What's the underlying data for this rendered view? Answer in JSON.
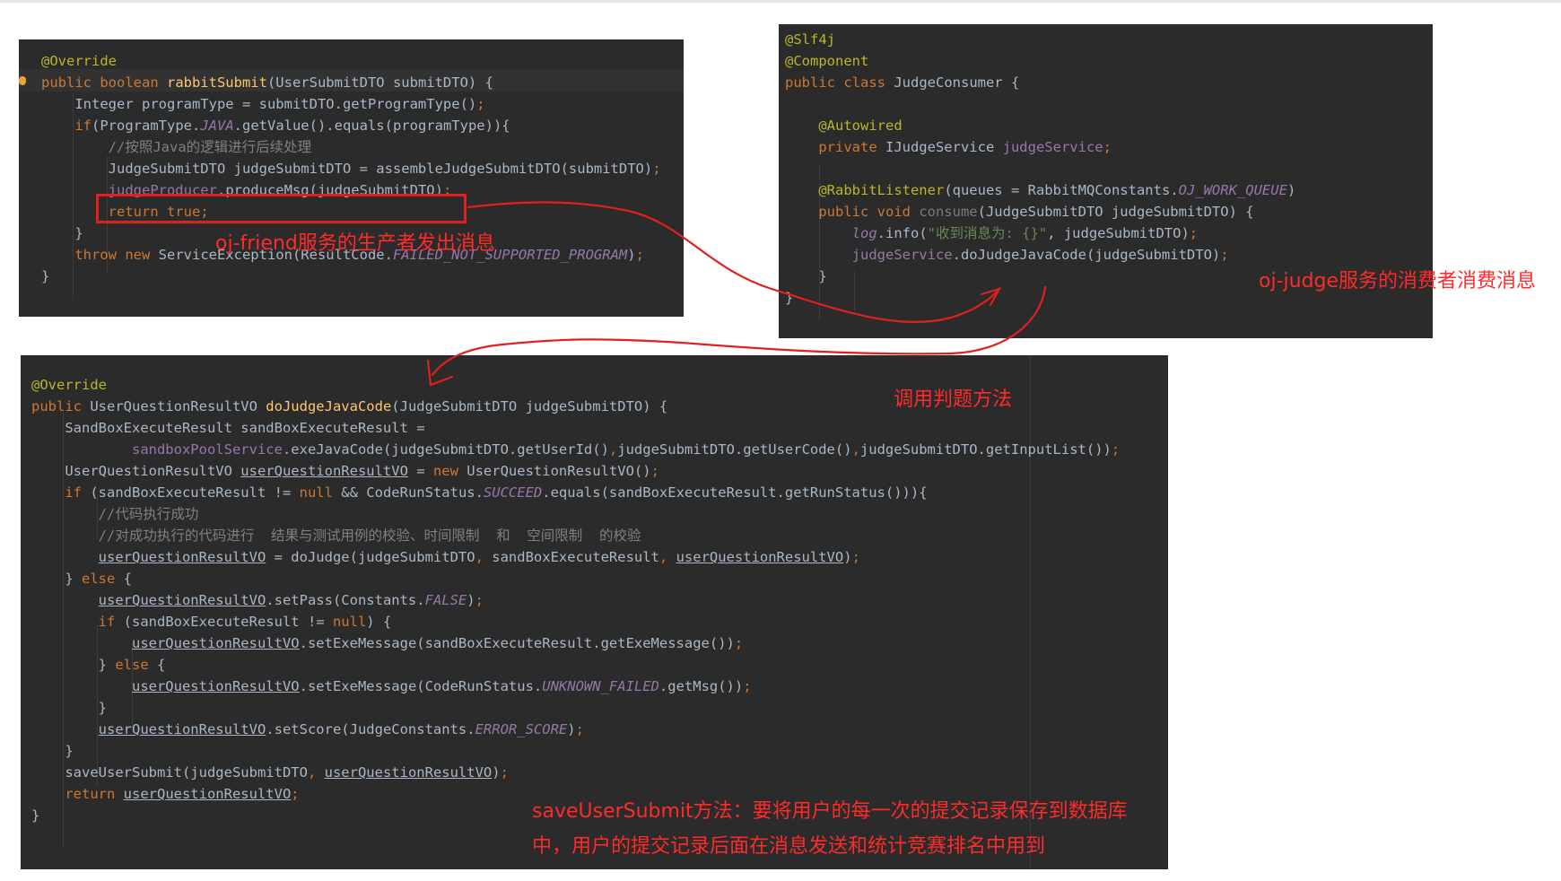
{
  "panel_friend": {
    "lines": [
      [
        {
          "t": "@Override",
          "c": "an"
        }
      ],
      [
        {
          "t": "public boolean ",
          "c": "k"
        },
        {
          "t": "rabbitSubmit",
          "c": "fn"
        },
        {
          "t": "(UserSubmitDTO submitDTO) {",
          "c": ""
        }
      ],
      [
        {
          "t": "    Integer programType = submitDTO.getProgramType()",
          "c": ""
        },
        {
          "t": ";",
          "c": "k"
        }
      ],
      [
        {
          "t": "    ",
          "c": ""
        },
        {
          "t": "if",
          "c": "k"
        },
        {
          "t": "(ProgramType.",
          "c": ""
        },
        {
          "t": "JAVA",
          "c": "cn"
        },
        {
          "t": ".getValue().equals(programType)){",
          "c": ""
        }
      ],
      [
        {
          "t": "        //按照Java的逻辑进行后续处理",
          "c": "cm"
        }
      ],
      [
        {
          "t": "        JudgeSubmitDTO judgeSubmitDTO = assembleJudgeSubmitDTO(submitDTO)",
          "c": ""
        },
        {
          "t": ";",
          "c": "k"
        }
      ],
      [
        {
          "t": "        ",
          "c": ""
        },
        {
          "t": "judgeProducer",
          "c": "fd"
        },
        {
          "t": ".produceMsg(judgeSubmitDTO)",
          "c": ""
        },
        {
          "t": ";",
          "c": "k"
        }
      ],
      [
        {
          "t": "        ",
          "c": ""
        },
        {
          "t": "return true;",
          "c": "k"
        }
      ],
      [
        {
          "t": "    }",
          "c": ""
        }
      ],
      [
        {
          "t": "    ",
          "c": ""
        },
        {
          "t": "throw new ",
          "c": "k"
        },
        {
          "t": "ServiceException(ResultCode.",
          "c": ""
        },
        {
          "t": "FAILED_NOT_SUPPORTED_PROGRAM",
          "c": "cn"
        },
        {
          "t": ")",
          "c": ""
        },
        {
          "t": ";",
          "c": "k"
        }
      ],
      [
        {
          "t": "}",
          "c": ""
        }
      ]
    ]
  },
  "panel_judge": {
    "lines": [
      [
        {
          "t": "@Slf4j",
          "c": "an"
        }
      ],
      [
        {
          "t": "@Component",
          "c": "an"
        }
      ],
      [
        {
          "t": "public class ",
          "c": "k"
        },
        {
          "t": "JudgeConsumer {",
          "c": ""
        }
      ],
      [
        {
          "t": "",
          "c": ""
        }
      ],
      [
        {
          "t": "    ",
          "c": ""
        },
        {
          "t": "@Autowired",
          "c": "an"
        }
      ],
      [
        {
          "t": "    ",
          "c": ""
        },
        {
          "t": "private ",
          "c": "k"
        },
        {
          "t": "IJudgeService ",
          "c": ""
        },
        {
          "t": "judgeService",
          "c": "fd"
        },
        {
          "t": ";",
          "c": "k"
        }
      ],
      [
        {
          "t": "",
          "c": ""
        }
      ],
      [
        {
          "t": "    ",
          "c": ""
        },
        {
          "t": "@RabbitListener",
          "c": "an"
        },
        {
          "t": "(queues = RabbitMQConstants.",
          "c": ""
        },
        {
          "t": "OJ_WORK_QUEUE",
          "c": "cn"
        },
        {
          "t": ")",
          "c": ""
        }
      ],
      [
        {
          "t": "    ",
          "c": ""
        },
        {
          "t": "public void ",
          "c": "k"
        },
        {
          "t": "consume",
          "c": "gray"
        },
        {
          "t": "(JudgeSubmitDTO judgeSubmitDTO) {",
          "c": ""
        }
      ],
      [
        {
          "t": "        ",
          "c": ""
        },
        {
          "t": "log",
          "c": "cn"
        },
        {
          "t": ".info(",
          "c": ""
        },
        {
          "t": "\"收到消息为: {}\"",
          "c": "st"
        },
        {
          "t": ", judgeSubmitDTO)",
          "c": ""
        },
        {
          "t": ";",
          "c": "k"
        }
      ],
      [
        {
          "t": "        ",
          "c": ""
        },
        {
          "t": "judgeService",
          "c": "fd"
        },
        {
          "t": ".doJudgeJavaCode(judgeSubmitDTO)",
          "c": ""
        },
        {
          "t": ";",
          "c": "k"
        }
      ],
      [
        {
          "t": "    }",
          "c": ""
        }
      ],
      [
        {
          "t": "}",
          "c": ""
        }
      ]
    ]
  },
  "panel_service": {
    "lines": [
      [
        {
          "t": "@Override",
          "c": "an"
        }
      ],
      [
        {
          "t": "public ",
          "c": "k"
        },
        {
          "t": "UserQuestionResultVO ",
          "c": ""
        },
        {
          "t": "doJudgeJavaCode",
          "c": "fn"
        },
        {
          "t": "(JudgeSubmitDTO judgeSubmitDTO) {",
          "c": ""
        }
      ],
      [
        {
          "t": "    SandBoxExecuteResult sandBoxExecuteResult =",
          "c": ""
        }
      ],
      [
        {
          "t": "            ",
          "c": ""
        },
        {
          "t": "sandboxPoolService",
          "c": "fd"
        },
        {
          "t": ".exeJavaCode(judgeSubmitDTO.getUserId()",
          "c": ""
        },
        {
          "t": ",",
          "c": "k"
        },
        {
          "t": "judgeSubmitDTO.getUserCode()",
          "c": ""
        },
        {
          "t": ",",
          "c": "k"
        },
        {
          "t": "judgeSubmitDTO.getInputList())",
          "c": ""
        },
        {
          "t": ";",
          "c": "k"
        }
      ],
      [
        {
          "t": "    UserQuestionResultVO ",
          "c": ""
        },
        {
          "t": "userQuestionResultVO",
          "c": "ul"
        },
        {
          "t": " = ",
          "c": ""
        },
        {
          "t": "new ",
          "c": "k"
        },
        {
          "t": "UserQuestionResultVO()",
          "c": ""
        },
        {
          "t": ";",
          "c": "k"
        }
      ],
      [
        {
          "t": "    ",
          "c": ""
        },
        {
          "t": "if ",
          "c": "k"
        },
        {
          "t": "(sandBoxExecuteResult != ",
          "c": ""
        },
        {
          "t": "null ",
          "c": "k"
        },
        {
          "t": "&& CodeRunStatus.",
          "c": ""
        },
        {
          "t": "SUCCEED",
          "c": "cn"
        },
        {
          "t": ".equals(sandBoxExecuteResult.getRunStatus())){",
          "c": ""
        }
      ],
      [
        {
          "t": "        //代码执行成功",
          "c": "cm"
        }
      ],
      [
        {
          "t": "        //对成功执行的代码进行  结果与测试用例的校验、时间限制  和  空间限制  的校验",
          "c": "cm"
        }
      ],
      [
        {
          "t": "        ",
          "c": ""
        },
        {
          "t": "userQuestionResultVO",
          "c": "ul"
        },
        {
          "t": " = doJudge(judgeSubmitDTO",
          "c": ""
        },
        {
          "t": ", ",
          "c": "k"
        },
        {
          "t": "sandBoxExecuteResult",
          "c": ""
        },
        {
          "t": ", ",
          "c": "k"
        },
        {
          "t": "userQuestionResultVO",
          "c": "ul"
        },
        {
          "t": ")",
          "c": ""
        },
        {
          "t": ";",
          "c": "k"
        }
      ],
      [
        {
          "t": "    } ",
          "c": ""
        },
        {
          "t": "else ",
          "c": "k"
        },
        {
          "t": "{",
          "c": ""
        }
      ],
      [
        {
          "t": "        ",
          "c": ""
        },
        {
          "t": "userQuestionResultVO",
          "c": "ul"
        },
        {
          "t": ".setPass(Constants.",
          "c": ""
        },
        {
          "t": "FALSE",
          "c": "cn"
        },
        {
          "t": ")",
          "c": ""
        },
        {
          "t": ";",
          "c": "k"
        }
      ],
      [
        {
          "t": "        ",
          "c": ""
        },
        {
          "t": "if ",
          "c": "k"
        },
        {
          "t": "(sandBoxExecuteResult != ",
          "c": ""
        },
        {
          "t": "null",
          "c": "k"
        },
        {
          "t": ") {",
          "c": ""
        }
      ],
      [
        {
          "t": "            ",
          "c": ""
        },
        {
          "t": "userQuestionResultVO",
          "c": "ul"
        },
        {
          "t": ".setExeMessage(sandBoxExecuteResult.getExeMessage())",
          "c": ""
        },
        {
          "t": ";",
          "c": "k"
        }
      ],
      [
        {
          "t": "        } ",
          "c": ""
        },
        {
          "t": "else ",
          "c": "k"
        },
        {
          "t": "{",
          "c": ""
        }
      ],
      [
        {
          "t": "            ",
          "c": ""
        },
        {
          "t": "userQuestionResultVO",
          "c": "ul"
        },
        {
          "t": ".setExeMessage(CodeRunStatus.",
          "c": ""
        },
        {
          "t": "UNKNOWN_FAILED",
          "c": "cn"
        },
        {
          "t": ".getMsg())",
          "c": ""
        },
        {
          "t": ";",
          "c": "k"
        }
      ],
      [
        {
          "t": "        }",
          "c": ""
        }
      ],
      [
        {
          "t": "        ",
          "c": ""
        },
        {
          "t": "userQuestionResultVO",
          "c": "ul"
        },
        {
          "t": ".setScore(JudgeConstants.",
          "c": ""
        },
        {
          "t": "ERROR_SCORE",
          "c": "cn"
        },
        {
          "t": ")",
          "c": ""
        },
        {
          "t": ";",
          "c": "k"
        }
      ],
      [
        {
          "t": "    }",
          "c": ""
        }
      ],
      [
        {
          "t": "    saveUserSubmit(judgeSubmitDTO",
          "c": ""
        },
        {
          "t": ", ",
          "c": "k"
        },
        {
          "t": "userQuestionResultVO",
          "c": "ul"
        },
        {
          "t": ")",
          "c": ""
        },
        {
          "t": ";",
          "c": "k"
        }
      ],
      [
        {
          "t": "    ",
          "c": ""
        },
        {
          "t": "return ",
          "c": "k"
        },
        {
          "t": "userQuestionResultVO",
          "c": "ul"
        },
        {
          "t": ";",
          "c": "k"
        }
      ],
      [
        {
          "t": "}",
          "c": ""
        }
      ]
    ]
  },
  "annotations": {
    "producer": "oj-friend服务的生产者发出消息",
    "consumer": "oj-judge服务的消费者消费消息",
    "call_judge": "调用判题方法",
    "save_line1": "saveUserSubmit方法：要将用户的每一次的提交记录保存到数据库",
    "save_line2": "中，用户的提交记录后面在消息发送和统计竞赛排名中用到"
  },
  "colors": {
    "editor_bg": "#2b2b2b",
    "annotation_red": "#ff2a2a",
    "arrow_red": "#e02020"
  }
}
